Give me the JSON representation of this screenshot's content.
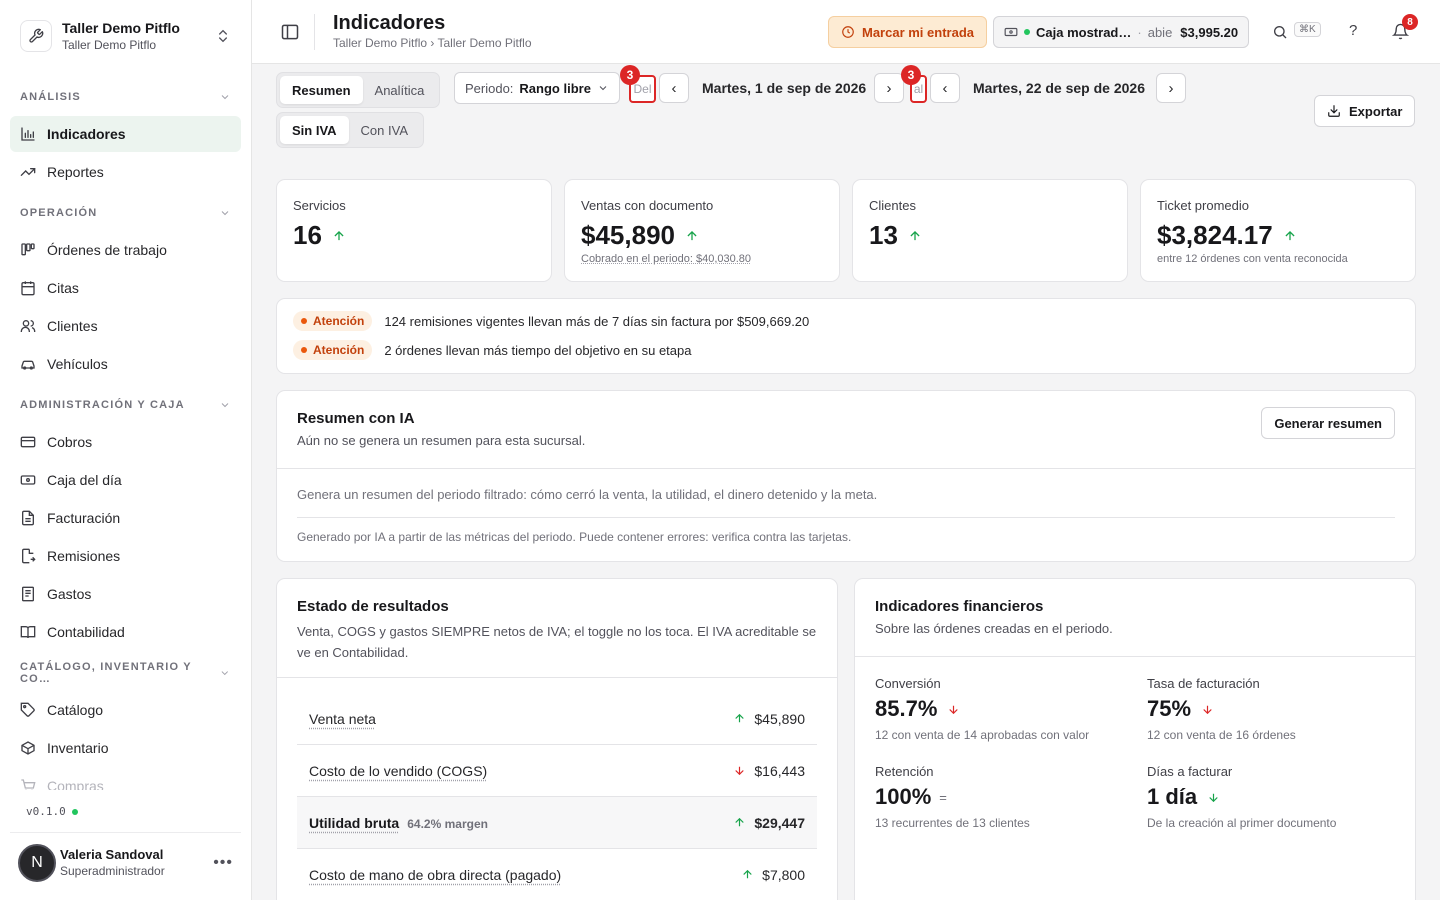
{
  "workspace": {
    "name": "Taller Demo Pitflo",
    "subtitle": "Taller Demo Pitflo"
  },
  "sidebar": {
    "sections": [
      {
        "label": "ANÁLISIS",
        "items": [
          {
            "label": "Indicadores",
            "icon": "bar-chart-icon",
            "active": true
          },
          {
            "label": "Reportes",
            "icon": "trending-up-icon"
          }
        ]
      },
      {
        "label": "OPERACIÓN",
        "items": [
          {
            "label": "Órdenes de trabajo",
            "icon": "kanban-icon"
          },
          {
            "label": "Citas",
            "icon": "calendar-icon"
          },
          {
            "label": "Clientes",
            "icon": "users-icon"
          },
          {
            "label": "Vehículos",
            "icon": "car-icon"
          }
        ]
      },
      {
        "label": "ADMINISTRACIÓN Y CAJA",
        "items": [
          {
            "label": "Cobros",
            "icon": "credit-card-icon"
          },
          {
            "label": "Caja del día",
            "icon": "cash-icon"
          },
          {
            "label": "Facturación",
            "icon": "file-text-icon"
          },
          {
            "label": "Remisiones",
            "icon": "file-export-icon"
          },
          {
            "label": "Gastos",
            "icon": "receipt-icon"
          },
          {
            "label": "Contabilidad",
            "icon": "book-icon"
          }
        ]
      },
      {
        "label": "CATÁLOGO, INVENTARIO Y CO…",
        "items": [
          {
            "label": "Catálogo",
            "icon": "tag-icon"
          },
          {
            "label": "Inventario",
            "icon": "box-icon"
          },
          {
            "label": "Compras",
            "icon": "cart-icon"
          }
        ]
      }
    ],
    "version": "v0.1.0",
    "user": {
      "initial": "N",
      "name": "Valeria Sandoval",
      "role": "Superadministrador"
    }
  },
  "header": {
    "title": "Indicadores",
    "breadcrumb": "Taller Demo Pitflo › Taller Demo Pitflo",
    "entry_button": "Marcar mi entrada",
    "register": {
      "name": "Caja mostrad…",
      "separator": "·",
      "status": "abie",
      "amount": "$3,995.20"
    },
    "search_shortcut": "⌘K",
    "help": "?",
    "notifications_count": "8"
  },
  "toolbar": {
    "view_tabs": [
      "Resumen",
      "Analítica"
    ],
    "period_label": "Periodo:",
    "period_value": "Rango libre",
    "from_label": "Del",
    "to_label": "al",
    "marker_count": "3",
    "prev": "‹",
    "next": "›",
    "from_date": "Martes, 1 de sep de 2026",
    "to_date": "Martes, 22 de sep de 2026",
    "tax_tabs": [
      "Sin IVA",
      "Con IVA"
    ],
    "export": "Exportar"
  },
  "kpis": [
    {
      "label": "Servicios",
      "value": "16",
      "trend": "up",
      "sub": ""
    },
    {
      "label": "Ventas con documento",
      "value": "$45,890",
      "trend": "up",
      "sub": "Cobrado en el periodo: $40,030.80"
    },
    {
      "label": "Clientes",
      "value": "13",
      "trend": "up",
      "sub": ""
    },
    {
      "label": "Ticket promedio",
      "value": "$3,824.17",
      "trend": "up",
      "sub": "entre 12 órdenes con venta reconocida"
    }
  ],
  "alerts": [
    {
      "badge": "Atención",
      "text": "124 remisiones vigentes llevan más de 7 días sin factura por $509,669.20"
    },
    {
      "badge": "Atención",
      "text": "2 órdenes llevan más tiempo del objetivo en su etapa"
    }
  ],
  "ai_summary": {
    "title": "Resumen con IA",
    "subtitle": "Aún no se genera un resumen para esta sucursal.",
    "button": "Generar resumen",
    "body": "Genera un resumen del periodo filtrado: cómo cerró la venta, la utilidad, el dinero detenido y la meta.",
    "disclaimer": "Generado por IA a partir de las métricas del periodo. Puede contener errores: verifica contra las tarjetas."
  },
  "income_statement": {
    "title": "Estado de resultados",
    "subtitle": "Venta, COGS y gastos SIEMPRE netos de IVA; el toggle no los toca. El IVA acreditable se ve en Contabilidad.",
    "rows": [
      {
        "label": "Venta neta",
        "trend": "up",
        "amount": "$45,890",
        "margin": ""
      },
      {
        "label": "Costo de lo vendido (COGS)",
        "trend": "down",
        "amount": "$16,443",
        "margin": ""
      },
      {
        "label": "Utilidad bruta",
        "trend": "up",
        "amount": "$29,447",
        "margin": "64.2% margen"
      },
      {
        "label": "Costo de mano de obra directa (pagado)",
        "trend": "up",
        "amount": "$7,800",
        "margin": ""
      }
    ]
  },
  "financial": {
    "title": "Indicadores financieros",
    "subtitle": "Sobre las órdenes creadas en el periodo.",
    "items": [
      {
        "label": "Conversión",
        "value": "85.7%",
        "trend": "down",
        "sub": "12 con venta de 14 aprobadas con valor"
      },
      {
        "label": "Tasa de facturación",
        "value": "75%",
        "trend": "down",
        "sub": "12 con venta de 16 órdenes"
      },
      {
        "label": "Retención",
        "value": "100%",
        "trend": "flat",
        "flat_symbol": "=",
        "sub": "13 recurrentes de 13 clientes"
      },
      {
        "label": "Días a facturar",
        "value": "1 día",
        "trend": "down-green",
        "sub": "De la creación al primer documento"
      }
    ]
  },
  "colors": {
    "accent": "#16a34a",
    "warning": "#c2410c",
    "danger": "#dc2626"
  }
}
